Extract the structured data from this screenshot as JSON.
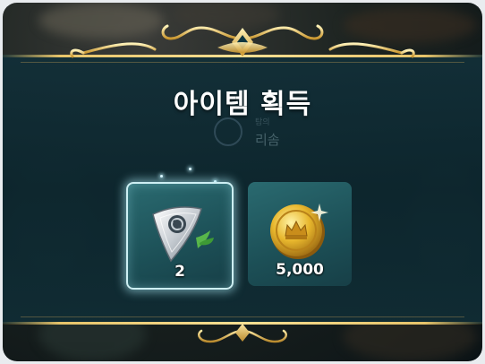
{
  "dialog": {
    "title": "아이템 획득",
    "background_label": "리솜",
    "background_sublabel": "탐의"
  },
  "items": [
    {
      "name": "shield-shard",
      "icon": "silver-shield-leaf-icon",
      "count": "2",
      "selected": true
    },
    {
      "name": "gold",
      "icon": "gold-coin-crown-icon",
      "count": "5,000",
      "selected": false
    }
  ],
  "colors": {
    "panel": "#143a44",
    "gold": "#e7c46a",
    "card": "#1f535a",
    "selected_glow": "#cdeff3"
  }
}
